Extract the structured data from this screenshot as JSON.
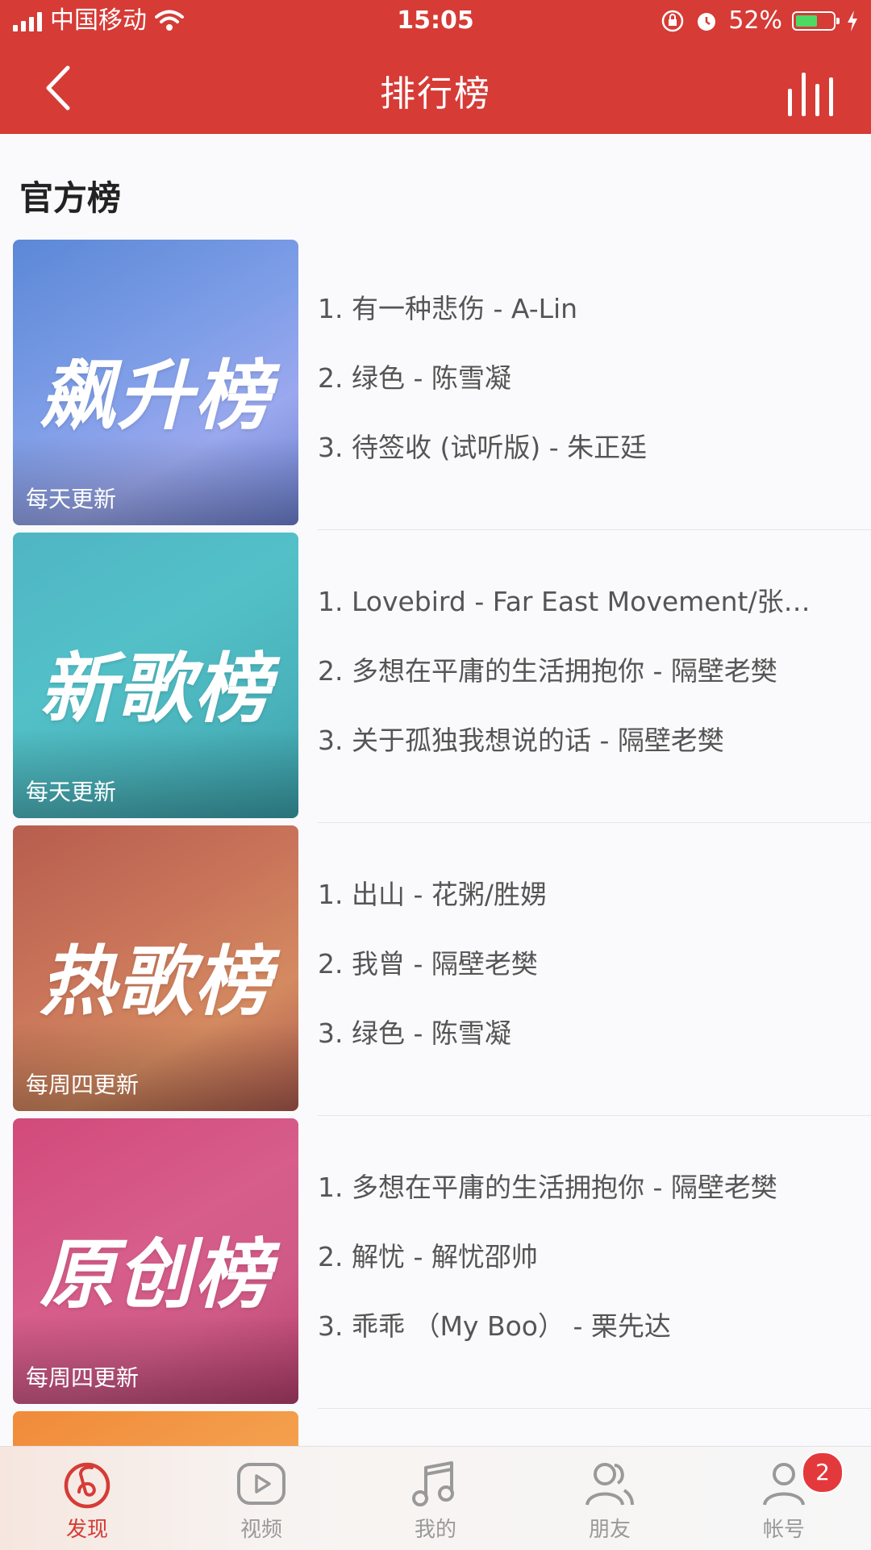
{
  "status_bar": {
    "carrier": "中国移动",
    "time": "15:05",
    "battery_percent": "52%",
    "battery_level": 0.52,
    "icons": [
      "signal-icon",
      "wifi-icon",
      "rotation-lock-icon",
      "alarm-icon",
      "battery-icon",
      "charging-icon"
    ]
  },
  "nav": {
    "title": "排行榜",
    "back_icon": "chevron-left-icon",
    "right_icon": "now-playing-icon"
  },
  "section": {
    "title": "官方榜"
  },
  "charts": [
    {
      "cover_text": "飙升榜",
      "update": "每天更新",
      "tracks": [
        "1. 有一种悲伤 - A-Lin",
        "2. 绿色 - 陈雪凝",
        "3. 待签收 (试听版) - 朱正廷"
      ]
    },
    {
      "cover_text": "新歌榜",
      "update": "每天更新",
      "tracks": [
        "1. Lovebird - Far East Movement/张…",
        "2. 多想在平庸的生活拥抱你 - 隔壁老樊",
        "3. 关于孤独我想说的话  - 隔壁老樊"
      ]
    },
    {
      "cover_text": "热歌榜",
      "update": "每周四更新",
      "tracks": [
        "1. 出山 - 花粥/胜娚",
        "2. 我曾 - 隔壁老樊",
        "3. 绿色 - 陈雪凝"
      ]
    },
    {
      "cover_text": "原创榜",
      "update": "每周四更新",
      "tracks": [
        "1. 多想在平庸的生活拥抱你 - 隔壁老樊",
        "2. 解忧 - 解忧邵帅",
        "3. 乖乖 （My Boo） - 栗先达"
      ]
    }
  ],
  "tabs": [
    {
      "label": "发现",
      "icon": "netease-music-icon",
      "active": true
    },
    {
      "label": "视频",
      "icon": "video-play-icon"
    },
    {
      "label": "我的",
      "icon": "music-note-icon"
    },
    {
      "label": "朋友",
      "icon": "friends-icon"
    },
    {
      "label": "帐号",
      "icon": "account-icon",
      "badge": "2"
    }
  ],
  "colors": {
    "brand": "#d63b36",
    "tab_inactive": "#999999"
  }
}
